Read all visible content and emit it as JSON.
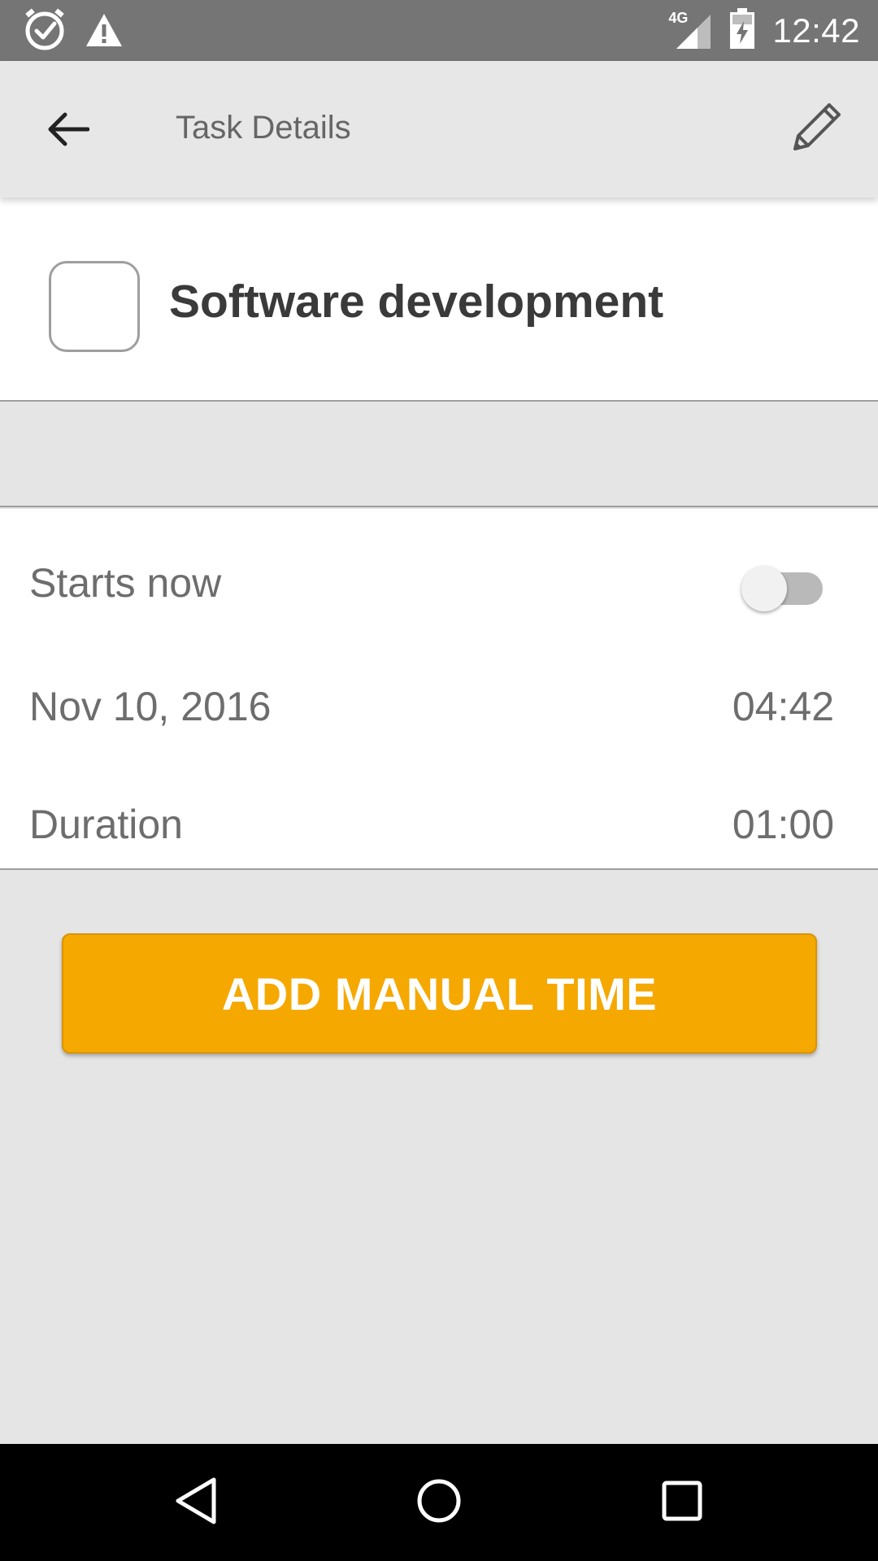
{
  "status_bar": {
    "time": "12:42",
    "network_type": "4G",
    "icons": [
      "task-clock-icon",
      "warning-icon",
      "signal-icon",
      "battery-icon"
    ]
  },
  "app_bar": {
    "title": "Task Details",
    "back_icon": "arrow-back-icon",
    "edit_icon": "pencil-icon"
  },
  "task": {
    "name": "Software development",
    "completed": false
  },
  "details": {
    "starts_now_label": "Starts now",
    "starts_now_enabled": false,
    "date": "Nov 10, 2016",
    "time": "04:42",
    "duration_label": "Duration",
    "duration_value": "01:00"
  },
  "actions": {
    "add_manual_time_label": "ADD MANUAL TIME"
  },
  "colors": {
    "accent": "#f5a800",
    "status_bar": "#757575",
    "app_bar": "#e7e7e7",
    "background": "#e5e5e5"
  }
}
